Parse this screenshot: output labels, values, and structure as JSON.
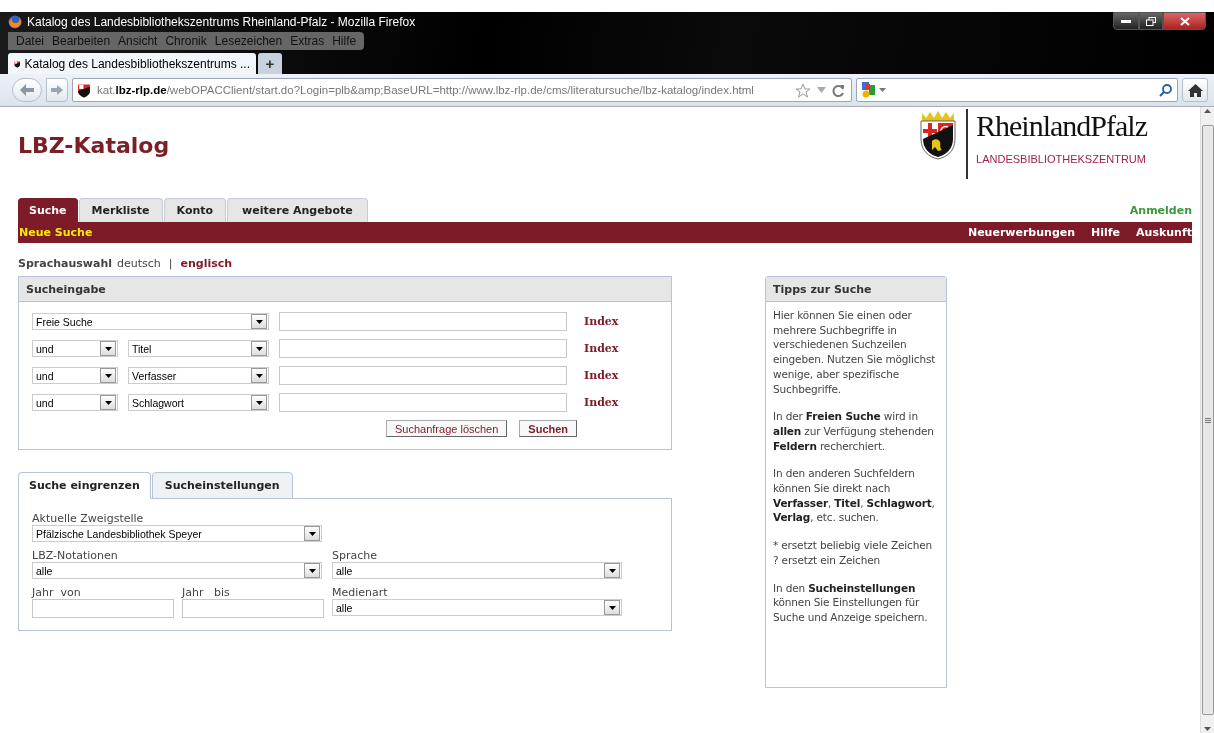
{
  "window": {
    "title": "Katalog des Landesbibliothekszentrums Rheinland-Pfalz - Mozilla Firefox"
  },
  "menu": [
    "Datei",
    "Bearbeiten",
    "Ansicht",
    "Chronik",
    "Lesezeichen",
    "Extras",
    "Hilfe"
  ],
  "browser_tabs": [
    {
      "label": "Katalog des Landesbibliothekszentrums ...",
      "selected": true
    }
  ],
  "new_tab": "+",
  "address_bar": {
    "url": "kat.**lbz-rlp.de**/webOPACClient/start.do?Login=plb&amp;BaseURL=http://www.lbz-rlp.de/cms/literatursuche/lbz-katalog/index.html"
  },
  "page": {
    "title": "LBZ-Katalog",
    "logo": {
      "name": "RheinlandPfalz",
      "subtitle": "LANDESBIBLIOTHEKSZENTRUM"
    },
    "nav_tabs": [
      {
        "label": "Suche",
        "selected": true
      },
      {
        "label": "Merkliste",
        "selected": false
      },
      {
        "label": "Konto",
        "selected": false
      },
      {
        "label": "weitere Angebote",
        "selected": false
      }
    ],
    "login_link": "Anmelden",
    "subnav": {
      "left": "Neue Suche",
      "right": [
        "Neuerwerbungen",
        "Hilfe",
        "Auskunft"
      ]
    },
    "language": {
      "label": "Sprachauswahl",
      "current": "deutsch",
      "separator": "|",
      "other": "englisch"
    },
    "search_panel": {
      "title": "Sucheingabe",
      "rows": [
        {
          "field": "Freie Suche",
          "index_link": "Index"
        },
        {
          "operator": "und",
          "field": "Titel",
          "index_link": "Index"
        },
        {
          "operator": "und",
          "field": "Verfasser",
          "index_link": "Index"
        },
        {
          "operator": "und",
          "field": "Schlagwort",
          "index_link": "Index"
        }
      ],
      "buttons": [
        {
          "label": "Suchanfrage löschen",
          "primary": false
        },
        {
          "label": "Suchen",
          "primary": true
        }
      ]
    },
    "filter_panel": {
      "tabs": [
        {
          "label": "Suche eingrenzen",
          "selected": true
        },
        {
          "label": "Sucheinstellungen",
          "selected": false
        }
      ],
      "branch": {
        "label": "Aktuelle Zweigstelle",
        "value": "Pfälzische Landesbibliothek Speyer"
      },
      "notation": {
        "label": "LBZ-Notationen",
        "value": "alle"
      },
      "language": {
        "label": "Sprache",
        "value": "alle"
      },
      "year_from": {
        "label": "Jahr  von"
      },
      "year_to": {
        "label": "Jahr   bis"
      },
      "media_type": {
        "label": "Medienart",
        "value": "alle"
      }
    },
    "tips": {
      "title": "Tipps zur Suche",
      "paragraphs": [
        {
          "kind": "rich",
          "lines": [
            "Hier können Sie einen oder mehrere Suchbegriffe in verschiedenen Suchzeilen eingeben. Nutzen Sie möglichst wenige, aber spezifische Suchbegriffe."
          ]
        },
        {
          "kind": "rich",
          "lines": [
            "In der **Freien Suche** wird in **allen** zur Verfügung stehenden **Feldern** recherchiert."
          ]
        },
        {
          "kind": "rich",
          "lines": [
            "In den anderen Suchfeldern können Sie direkt nach **Verfasser**, **Titel**, **Schlagwort**, **Verlag**, etc. suchen."
          ]
        },
        {
          "kind": "plain",
          "lines": [
            "* ersetzt beliebig viele Zeichen",
            "? ersetzt ein Zeichen"
          ]
        },
        {
          "kind": "rich",
          "lines": [
            "In den **Sucheinstellungen** können Sie Einstellungen für Suche und Anzeige speichern."
          ]
        }
      ]
    }
  }
}
